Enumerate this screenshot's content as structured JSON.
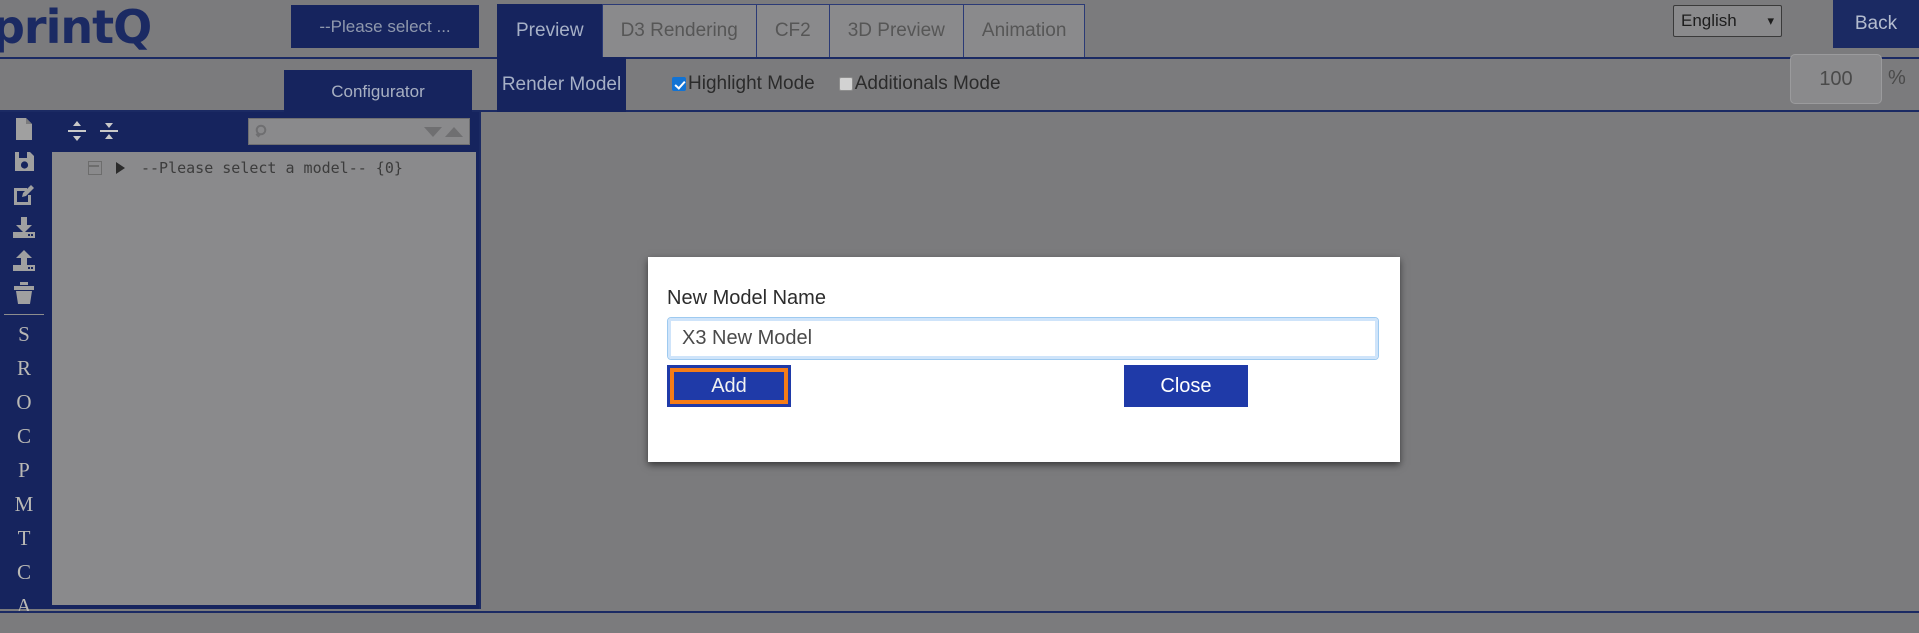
{
  "header": {
    "logo_text": "printQ",
    "model_select_label": "--Please select ...",
    "configurator_label": "Configurator",
    "language_value": "English",
    "language_caret": "chevron-down",
    "back_label": "Back",
    "zoom_value": "100",
    "zoom_unit": "%"
  },
  "tabs": [
    {
      "label": "Preview",
      "active": true
    },
    {
      "label": "D3 Rendering",
      "active": false
    },
    {
      "label": "CF2",
      "active": false
    },
    {
      "label": "3D Preview",
      "active": false
    },
    {
      "label": "Animation",
      "active": false
    }
  ],
  "subtab": {
    "render_model_label": "Render Model"
  },
  "modes": [
    {
      "label": "Highlight Mode",
      "checked": true
    },
    {
      "label": "Additionals Mode",
      "checked": false
    }
  ],
  "rail": {
    "icons": [
      {
        "name": "new-file-icon"
      },
      {
        "name": "save-icon"
      },
      {
        "name": "edit-icon"
      },
      {
        "name": "download-icon"
      },
      {
        "name": "upload-icon"
      },
      {
        "name": "delete-icon"
      }
    ],
    "letters": [
      "S",
      "R",
      "O",
      "C",
      "P",
      "M",
      "T",
      "C",
      "A"
    ]
  },
  "tree": {
    "expand_all_icon": "expand-all-icon",
    "collapse_all_icon": "collapse-all-icon",
    "search_placeholder": "",
    "search_value": "",
    "sort_desc_icon": "sort-descending-icon",
    "sort_asc_icon": "sort-ascending-icon",
    "root_node_label": "--Please select a model-- {0}"
  },
  "modal": {
    "label": "New Model Name",
    "input_value": "X3 New Model",
    "input_placeholder": "",
    "add_label": "Add",
    "close_label": "Close"
  },
  "colors": {
    "brand_navy": "#16245e",
    "page_gray": "#7b7b7d",
    "panel_gray": "#8a8a8c",
    "button_blue": "#1f3aa8",
    "highlight_orange": "#f57c18",
    "checkbox_blue": "#1273d4"
  }
}
